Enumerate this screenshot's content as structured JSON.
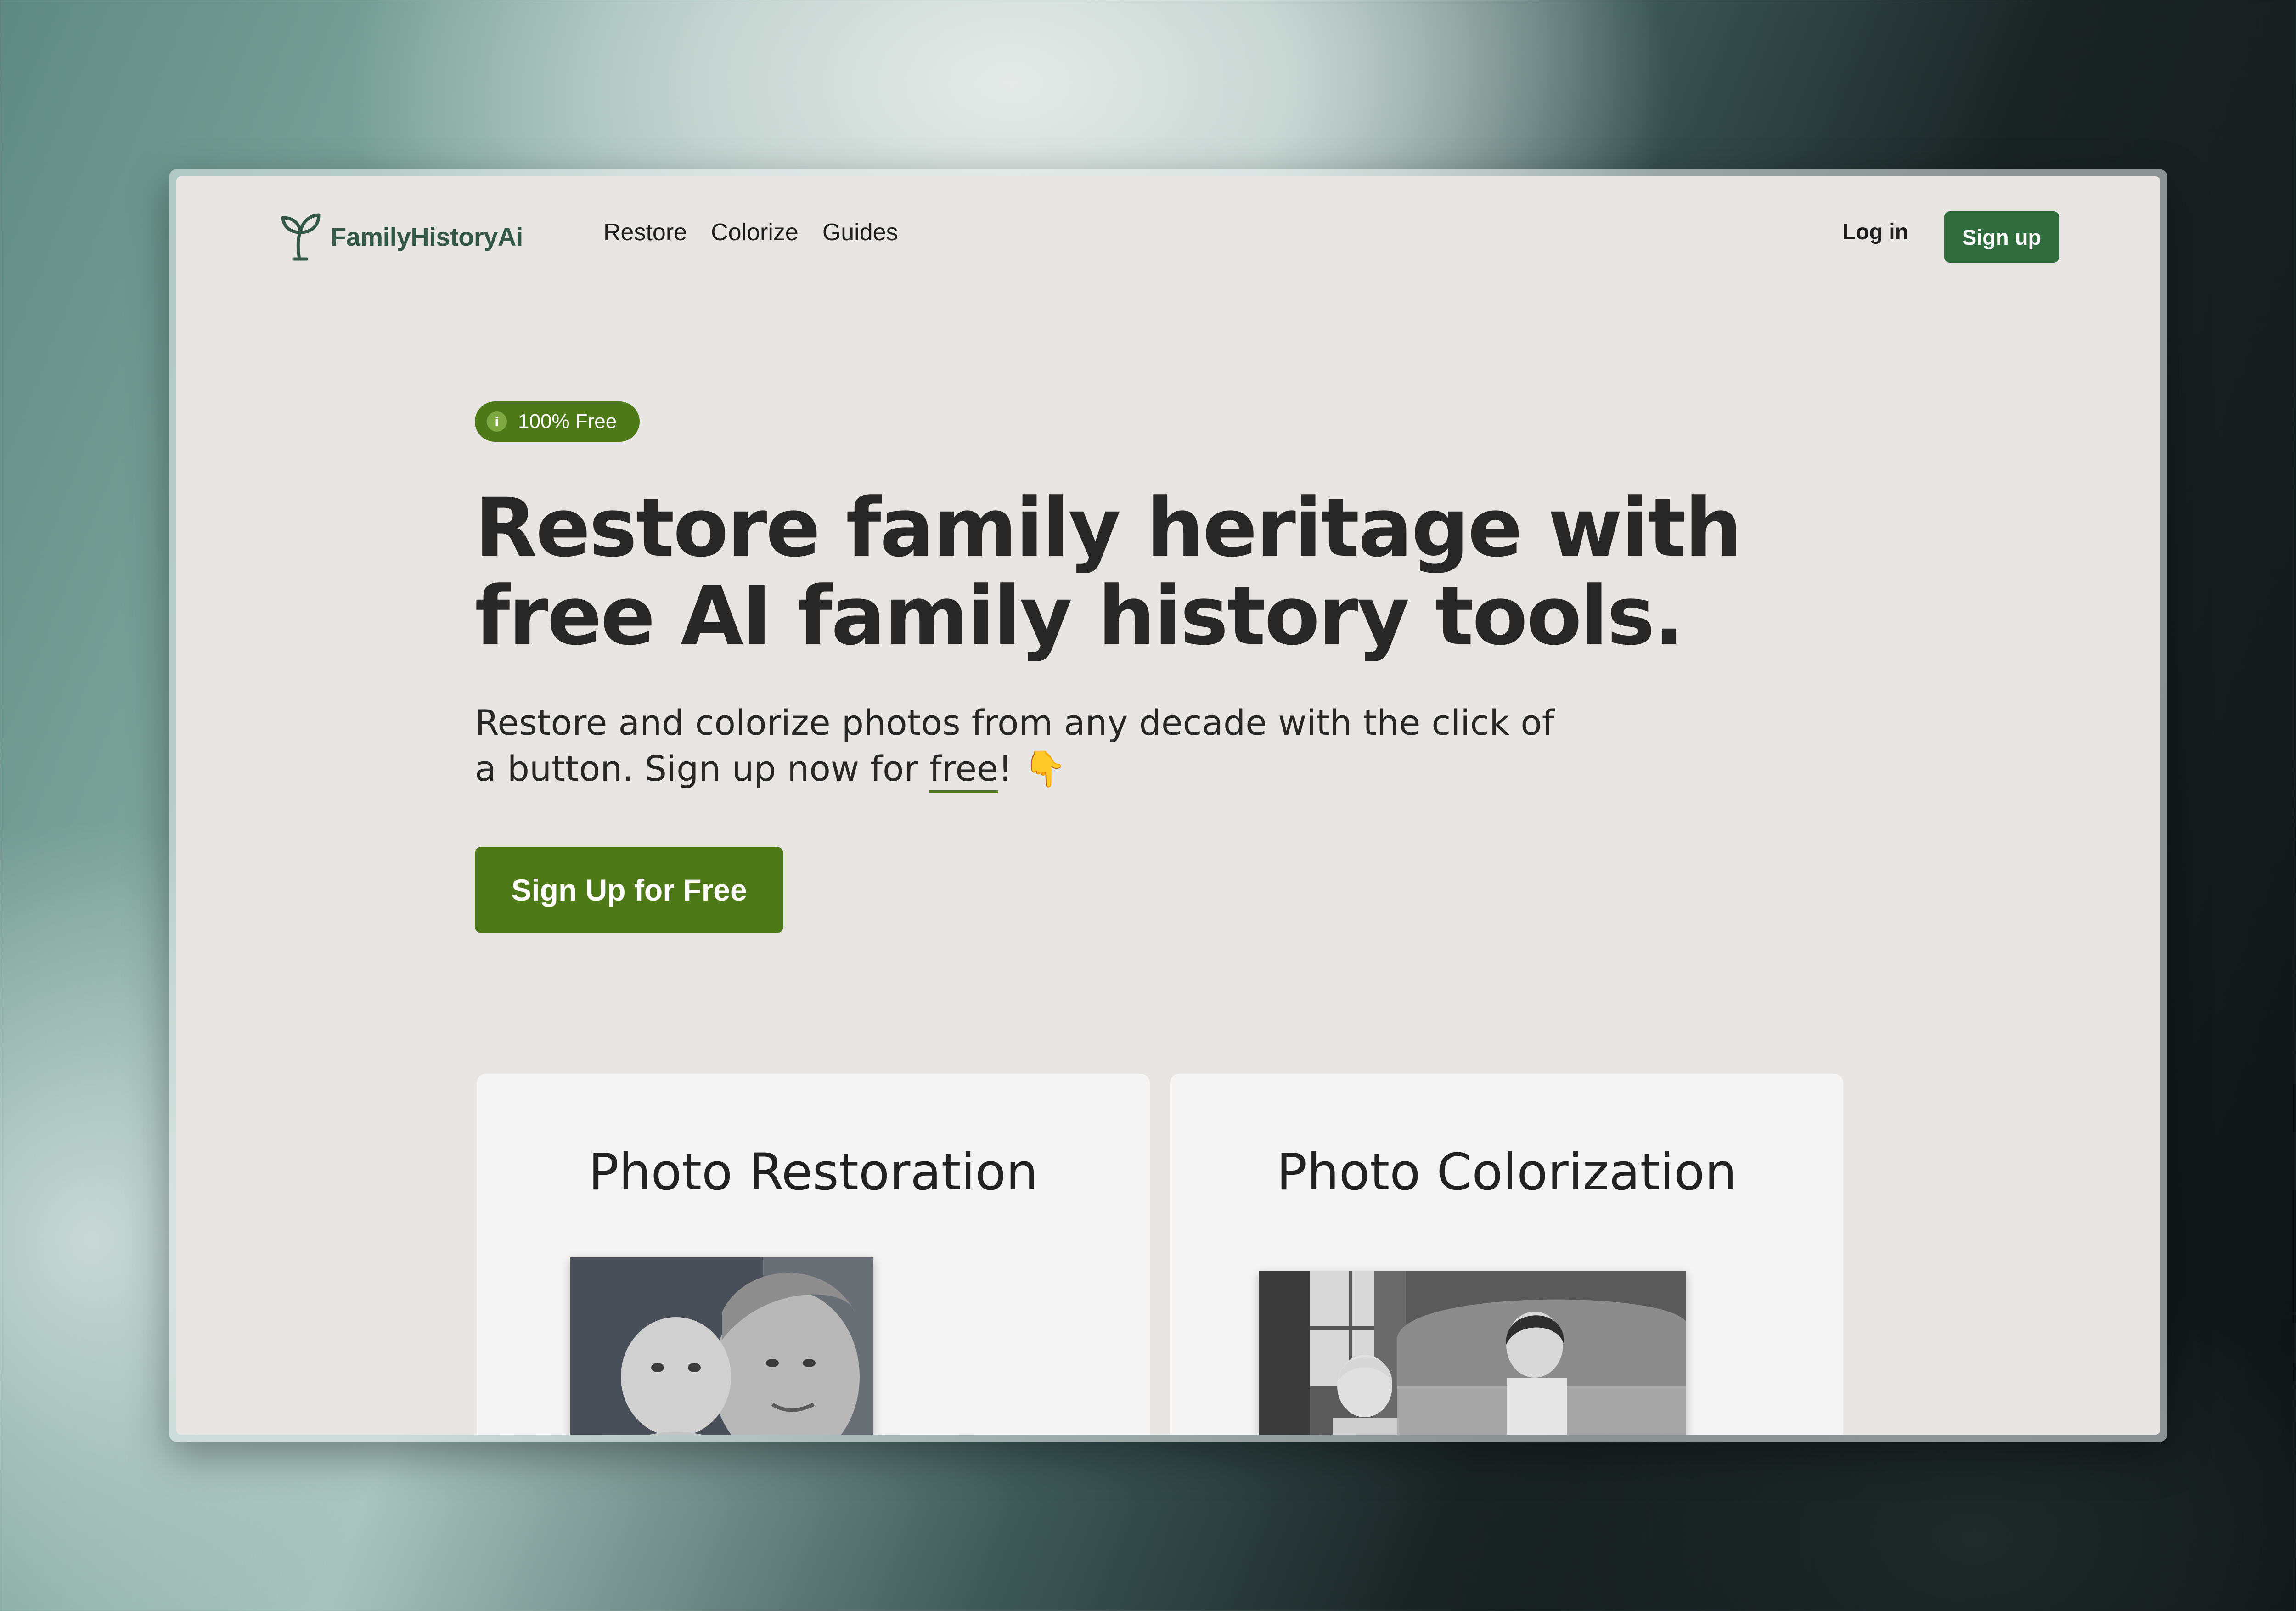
{
  "brand": {
    "name": "FamilyHistoryAi",
    "color": "#35574a"
  },
  "nav": {
    "links": [
      "Restore",
      "Colorize",
      "Guides"
    ],
    "login_label": "Log in",
    "signup_label": "Sign up",
    "signup_color": "#2f6b3c"
  },
  "hero": {
    "badge": "100% Free",
    "badge_icon": "info-icon",
    "title": "Restore family heritage with free AI family history tools.",
    "subtitle_before": "Restore and colorize photos from any decade with the click of a button. Sign up now for ",
    "subtitle_free": "free",
    "subtitle_after": "! ",
    "subtitle_emoji": "👇",
    "cta_label": "Sign Up for Free",
    "accent_color": "#4f7818"
  },
  "cards": [
    {
      "title": "Photo Restoration",
      "image": "black-and-white-photo-mother-and-baby"
    },
    {
      "title": "Photo Colorization",
      "image": "black-and-white-photo-two-children-on-sofa"
    }
  ]
}
